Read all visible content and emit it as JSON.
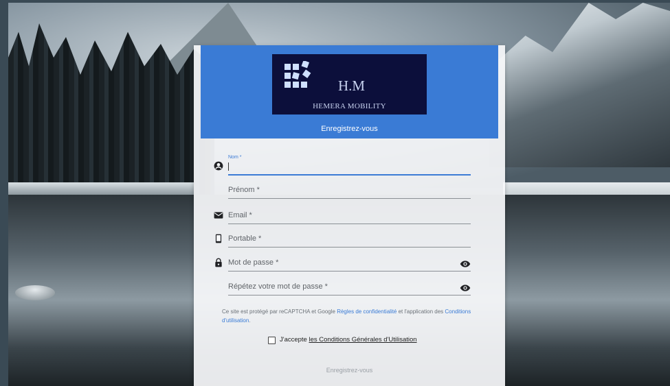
{
  "brand": {
    "logo_title": "H.M",
    "logo_subtitle": "HEMERA MOBILITY",
    "header_color": "#3a7bd5",
    "logo_bg": "#0c0f3b"
  },
  "form": {
    "title": "Enregistrez-vous",
    "fields": {
      "nom": {
        "label": "Nom *",
        "value": "",
        "icon": "account-circle-icon"
      },
      "prenom": {
        "label": "Prénom *",
        "value": ""
      },
      "email": {
        "label": "Email *",
        "value": "",
        "icon": "email-icon"
      },
      "portable": {
        "label": "Portable *",
        "value": "",
        "icon": "phone-icon"
      },
      "password": {
        "label": "Mot de passe *",
        "value": "",
        "icon": "lock-icon",
        "toggle_icon": "eye-icon"
      },
      "password_repeat": {
        "label": "Répétez votre mot de passe *",
        "value": "",
        "toggle_icon": "eye-icon"
      }
    },
    "notice": {
      "prefix": "Ce site est protégé par reCAPTCHA et Google ",
      "privacy_link": "Règles de confidentialité",
      "middle": " et l'application des ",
      "terms_link": "Conditions d'utilisation",
      "suffix": "."
    },
    "accept": {
      "prefix": "J'accepte ",
      "link": "les Conditions Générales d'Utilisation",
      "checked": false
    },
    "submit_label": "Enregistrez-vous"
  }
}
